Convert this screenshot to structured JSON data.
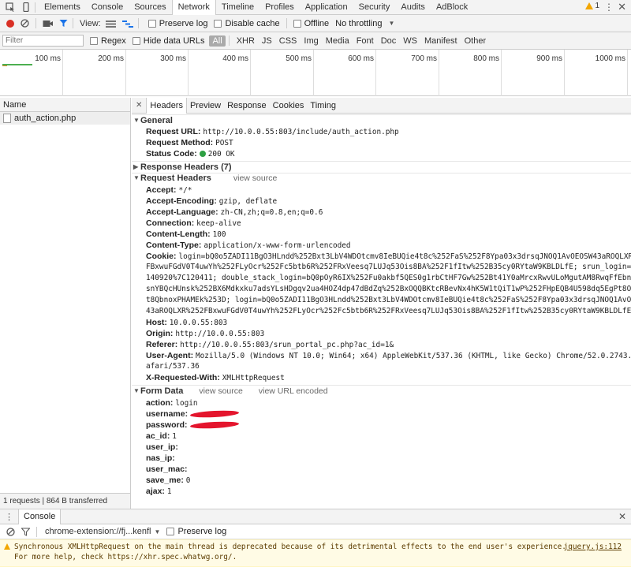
{
  "topbar": {
    "tabs": [
      "Elements",
      "Console",
      "Sources",
      "Network",
      "Timeline",
      "Profiles",
      "Application",
      "Security",
      "Audits",
      "AdBlock"
    ],
    "active_tab": "Network",
    "warning_count": "1"
  },
  "toolbar": {
    "view_label": "View:",
    "preserve_log": "Preserve log",
    "disable_cache": "Disable cache",
    "offline": "Offline",
    "throttle": "No throttling"
  },
  "filterbar": {
    "placeholder": "Filter",
    "regex": "Regex",
    "hide_data_urls": "Hide data URLs",
    "types": [
      "All",
      "XHR",
      "JS",
      "CSS",
      "Img",
      "Media",
      "Font",
      "Doc",
      "WS",
      "Manifest",
      "Other"
    ]
  },
  "timeline": {
    "ticks": [
      "100 ms",
      "200 ms",
      "300 ms",
      "400 ms",
      "500 ms",
      "600 ms",
      "700 ms",
      "800 ms",
      "900 ms",
      "1000 ms"
    ]
  },
  "leftpane": {
    "header": "Name",
    "request": "auth_action.php",
    "footer": "1 requests  |  864 B transferred"
  },
  "detail": {
    "tabs": [
      "Headers",
      "Preview",
      "Response",
      "Cookies",
      "Timing"
    ],
    "general": {
      "title": "General",
      "request_url_k": "Request URL:",
      "request_url_v": "http://10.0.0.55:803/include/auth_action.php",
      "method_k": "Request Method:",
      "method_v": "POST",
      "status_k": "Status Code:",
      "status_v": "200 OK"
    },
    "response_headers": {
      "title": "Response Headers (7)"
    },
    "request_headers": {
      "title": "Request Headers",
      "view_source": "view source",
      "accept_k": "Accept:",
      "accept_v": "*/*",
      "enc_k": "Accept-Encoding:",
      "enc_v": "gzip, deflate",
      "lang_k": "Accept-Language:",
      "lang_v": "zh-CN,zh;q=0.8,en;q=0.6",
      "conn_k": "Connection:",
      "conn_v": "keep-alive",
      "len_k": "Content-Length:",
      "len_v": "100",
      "type_k": "Content-Type:",
      "type_v": "application/x-www-form-urlencoded",
      "cookie_k": "Cookie:",
      "cookie_l1": "login=bQ0o5ZADI11BgO3HLndd%252Bxt3LbV4WDOtcmv8IeBUQie4t8c%252FaS%252F8Ypa03x3drsqJNOQ1AvOEOSW43aROQLXR%25",
      "cookie_l2": "FBxwuFGdV0T4uwYh%252FLyOcr%252Fc5btb6R%252FRxVeesq7LUJq53Ois8BA%252F1fItw%252B35cy0RYtaW9KBLDLfE; srun_login=2120",
      "cookie_l3": "140920%7C120411; double_stack_login=bQ0pOyR6IX%252Fu0akbf5QES0g1rbCtHF7Gw%252Bt41Y0aMrcxRwvULoMgutAM8RwqFfEbnpP0X",
      "cookie_l4": "snYBQcHUnsk%252BX6Mdkxku7adsYLsHDgqv2ua4HOZ4dp47dBdZq%252BxOQQBKtcRBevNx4hK5W1tQiT1wP%252FHpEQB4U598dq5EgPt8O6FOR",
      "cookie_l5": "t8QbnoxPHAMEk%253D; login=bQ0o5ZADI11BgO3HLndd%252Bxt3LbV4WDOtcmv8IeBUQie4t8c%252FaS%252F8Ypa03x3drsqJNOQ1AvOEOSW",
      "cookie_l6": "43aROQLXR%252FBxwuFGdV0T4uwYh%252FLyOcr%252Fc5btb6R%252FRxVeesq7LUJq53Ois8BA%252F1fItw%252B35cy0RYtaW9KBLDLfE",
      "host_k": "Host:",
      "host_v": "10.0.0.55:803",
      "origin_k": "Origin:",
      "origin_v": "http://10.0.0.55:803",
      "referer_k": "Referer:",
      "referer_v": "http://10.0.0.55:803/srun_portal_pc.php?ac_id=1&",
      "ua_k": "User-Agent:",
      "ua_l1": "Mozilla/5.0 (Windows NT 10.0; Win64; x64) AppleWebKit/537.36 (KHTML, like Gecko) Chrome/52.0.2743.82 S",
      "ua_l2": "afari/537.36",
      "xrw_k": "X-Requested-With:",
      "xrw_v": "XMLHttpRequest"
    },
    "form_data": {
      "title": "Form Data",
      "view_source": "view source",
      "view_url_encoded": "view URL encoded",
      "action_k": "action:",
      "action_v": "login",
      "username_k": "username:",
      "password_k": "password:",
      "acid_k": "ac_id:",
      "acid_v": "1",
      "userip_k": "user_ip:",
      "nasip_k": "nas_ip:",
      "usermac_k": "user_mac:",
      "saveme_k": "save_me:",
      "saveme_v": "0",
      "ajax_k": "ajax:",
      "ajax_v": "1"
    }
  },
  "drawer": {
    "tab": "Console",
    "context": "chrome-extension://fj...kenfl",
    "preserve_log": "Preserve log",
    "message_l1": "Synchronous XMLHttpRequest on the main thread is deprecated because of its detrimental effects to the end user's experience.",
    "message_l2": "For more help, check https://xhr.spec.whatwg.org/.",
    "source": "jquery.js:112"
  },
  "colors": {
    "status_ok": "#2ea043",
    "warning_bg": "#fffbe5",
    "redaction": "#e4152d"
  }
}
